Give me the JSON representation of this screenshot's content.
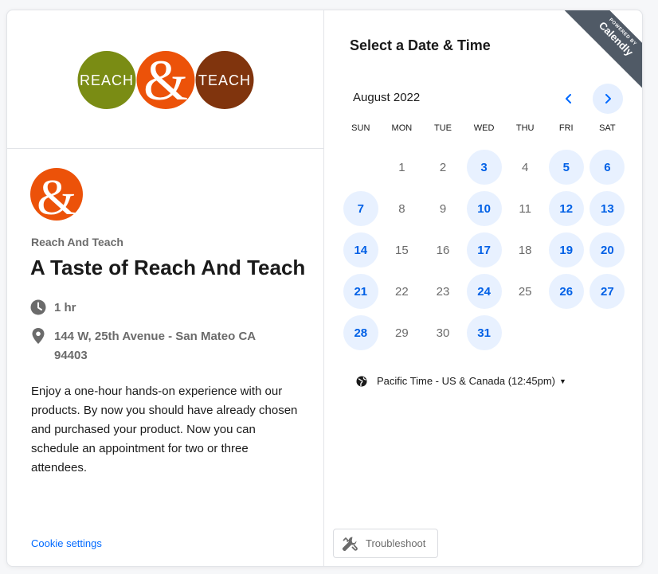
{
  "brand": {
    "logo_words": [
      "REACH",
      "&",
      "TEACH"
    ],
    "colors": {
      "green": "#7a8c14",
      "orange": "#ec5209",
      "brown": "#80340d",
      "accent_blue": "#0069ff",
      "ribbon": "#505a66"
    }
  },
  "ribbon": {
    "line1": "POWERED BY",
    "line2": "Calendly"
  },
  "event": {
    "organizer": "Reach And Teach",
    "title": "A Taste of Reach And Teach",
    "duration": "1 hr",
    "location": "144 W, 25th Avenue - San Mateo CA 94403",
    "description": "Enjoy a one-hour hands-on experience with our products. By now you should have already chosen and purchased your product. Now you can schedule an appointment for two or three attendees.",
    "icons": {
      "duration": "clock-icon",
      "location": "map-pin-icon"
    }
  },
  "calendar": {
    "heading": "Select a Date & Time",
    "month": "August 2022",
    "weekdays": [
      "SUN",
      "MON",
      "TUE",
      "WED",
      "THU",
      "FRI",
      "SAT"
    ],
    "days": [
      {
        "d": "",
        "avail": false
      },
      {
        "d": "1",
        "avail": false
      },
      {
        "d": "2",
        "avail": false
      },
      {
        "d": "3",
        "avail": true
      },
      {
        "d": "4",
        "avail": false
      },
      {
        "d": "5",
        "avail": true
      },
      {
        "d": "6",
        "avail": true
      },
      {
        "d": "7",
        "avail": true
      },
      {
        "d": "8",
        "avail": false
      },
      {
        "d": "9",
        "avail": false
      },
      {
        "d": "10",
        "avail": true
      },
      {
        "d": "11",
        "avail": false
      },
      {
        "d": "12",
        "avail": true
      },
      {
        "d": "13",
        "avail": true
      },
      {
        "d": "14",
        "avail": true
      },
      {
        "d": "15",
        "avail": false
      },
      {
        "d": "16",
        "avail": false
      },
      {
        "d": "17",
        "avail": true
      },
      {
        "d": "18",
        "avail": false
      },
      {
        "d": "19",
        "avail": true
      },
      {
        "d": "20",
        "avail": true
      },
      {
        "d": "21",
        "avail": true
      },
      {
        "d": "22",
        "avail": false
      },
      {
        "d": "23",
        "avail": false
      },
      {
        "d": "24",
        "avail": true
      },
      {
        "d": "25",
        "avail": false
      },
      {
        "d": "26",
        "avail": true
      },
      {
        "d": "27",
        "avail": true
      },
      {
        "d": "28",
        "avail": true
      },
      {
        "d": "29",
        "avail": false
      },
      {
        "d": "30",
        "avail": false
      },
      {
        "d": "31",
        "avail": true
      }
    ],
    "timezone": "Pacific Time - US & Canada (12:45pm)"
  },
  "footer": {
    "cookie_settings": "Cookie settings",
    "troubleshoot": "Troubleshoot"
  }
}
